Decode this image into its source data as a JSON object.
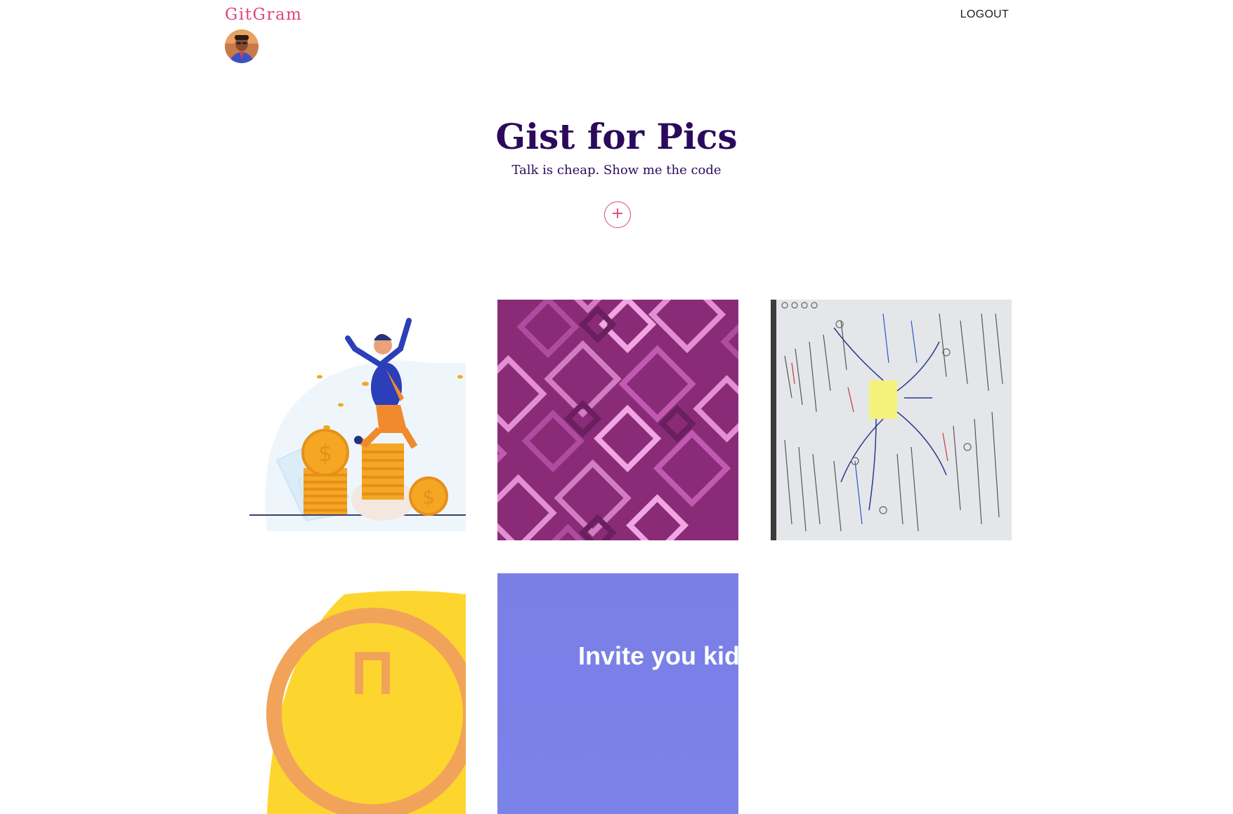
{
  "navbar": {
    "brand": "GitGram",
    "logout_label": "LOGOUT",
    "avatar_icon": "user-avatar",
    "brand_color": "#e1457e"
  },
  "hero": {
    "title": "Gist for Pics",
    "subtitle": "Talk is cheap. Show me the code",
    "add_icon": "plus-icon",
    "add_label": "+",
    "title_color": "#2b0a5c"
  },
  "gallery": {
    "items": [
      {
        "name": "gallery-item-jumping-man-coins",
        "description": "illustration"
      },
      {
        "name": "gallery-item-purple-pattern",
        "description": "abstract pattern"
      },
      {
        "name": "gallery-item-whiteboard-notes",
        "description": "whiteboard photo"
      },
      {
        "name": "gallery-item-yellow-coin",
        "description": "illustration"
      },
      {
        "name": "gallery-item-invite-banner",
        "description": "banner",
        "text": "Invite you kid"
      }
    ]
  }
}
